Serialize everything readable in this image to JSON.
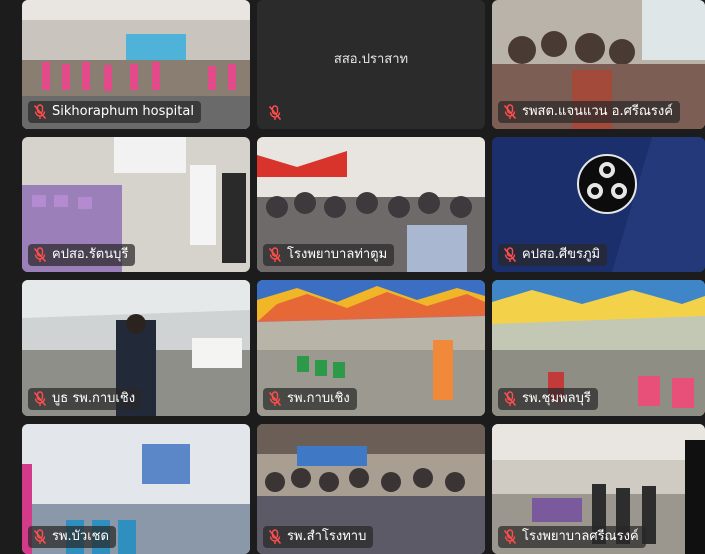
{
  "app": {
    "view": "gallery"
  },
  "icons": {
    "muted": "mic-muted-icon",
    "obs": "obs-logo-icon"
  },
  "colors": {
    "muted_icon": "#ff4d4d",
    "label_bg": "#282828",
    "obs_bg": "#1a2f6b"
  },
  "tiles": [
    {
      "name": "Sikhoraphum hospital",
      "muted": true
    },
    {
      "name": "สสอ.ปราสาท",
      "muted": true,
      "video": false
    },
    {
      "name": "รพสต.แจนแวน อ.ศรีณรงค์",
      "muted": true
    },
    {
      "name": "คปสอ.รัตนบุรี",
      "muted": true
    },
    {
      "name": "โรงพยาบาลท่าตูม",
      "muted": true
    },
    {
      "name": "คปสอ.ศีขรภูมิ",
      "muted": true
    },
    {
      "name": "บูธ รพ.กาบเชิง",
      "muted": true
    },
    {
      "name": "รพ.กาบเชิง",
      "muted": true
    },
    {
      "name": "รพ.ชุมพลบุรี",
      "muted": true
    },
    {
      "name": "รพ.บัวเชด",
      "muted": true
    },
    {
      "name": "รพ.สำโรงทาบ",
      "muted": true
    },
    {
      "name": "โรงพยาบาลศรีณรงค์",
      "muted": true
    }
  ]
}
